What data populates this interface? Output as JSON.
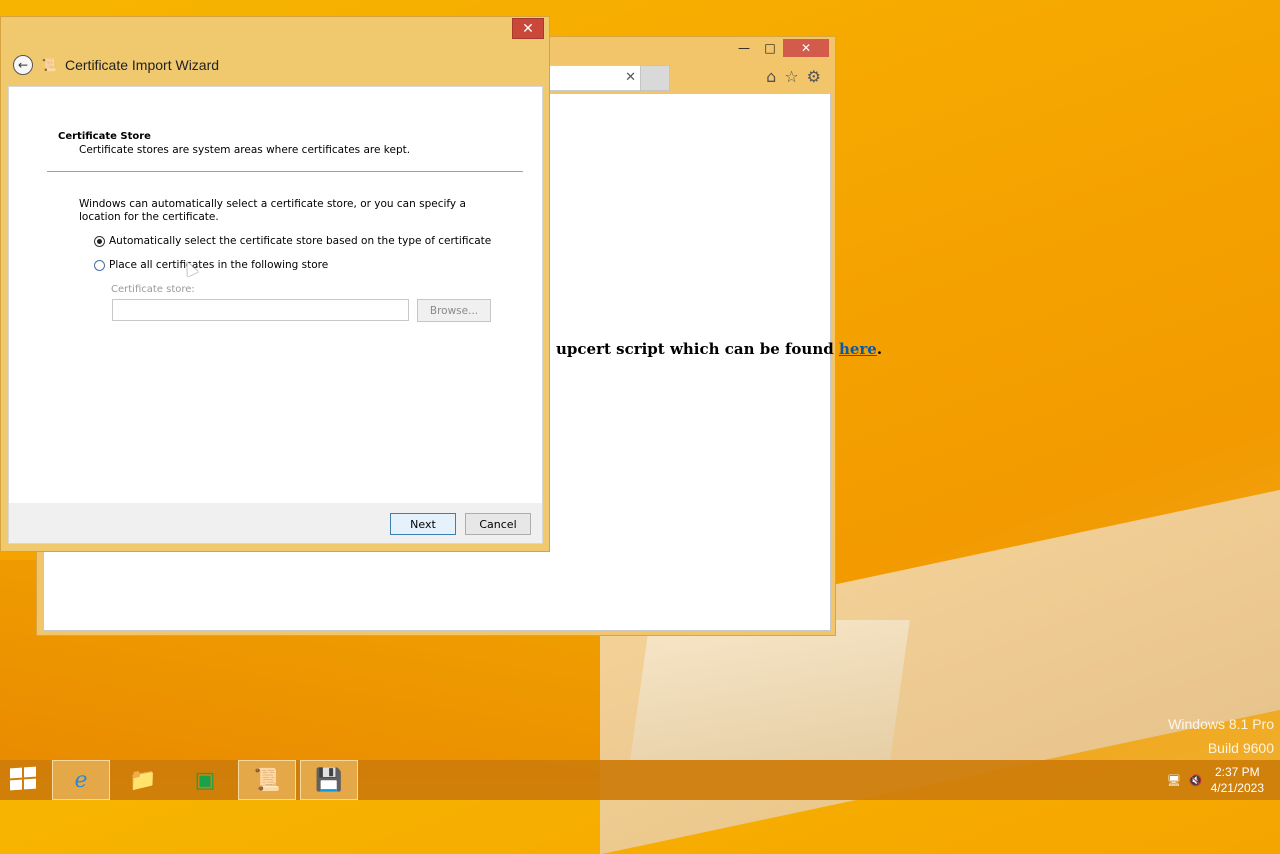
{
  "desktop": {
    "watermark_line1": "Windows 8.1 Pro",
    "watermark_line2": "Build 9600"
  },
  "browser": {
    "text_before_link": "upcert script which can be found ",
    "link_text": "here",
    "text_after_link": "."
  },
  "wizard": {
    "title": "Certificate Import Wizard",
    "section_title": "Certificate Store",
    "section_desc": "Certificate stores are system areas where certificates are kept.",
    "intro": "Windows can automatically select a certificate store, or you can specify a location for the certificate.",
    "option_auto": "Automatically select the certificate store based on the type of certificate",
    "option_manual": "Place all certificates in the following store",
    "store_label": "Certificate store:",
    "store_value": "",
    "browse_label": "Browse...",
    "next_label": "Next",
    "cancel_label": "Cancel",
    "selected_option": "auto"
  },
  "taskbar": {
    "time": "2:37 PM",
    "date": "4/21/2023",
    "items": [
      "internet-explorer",
      "file-explorer",
      "store",
      "certificate",
      "certificate-import-wizard"
    ]
  },
  "colors": {
    "accent": "#f0c96e",
    "link": "#0b5aa8",
    "close_red": "#c9483a"
  }
}
